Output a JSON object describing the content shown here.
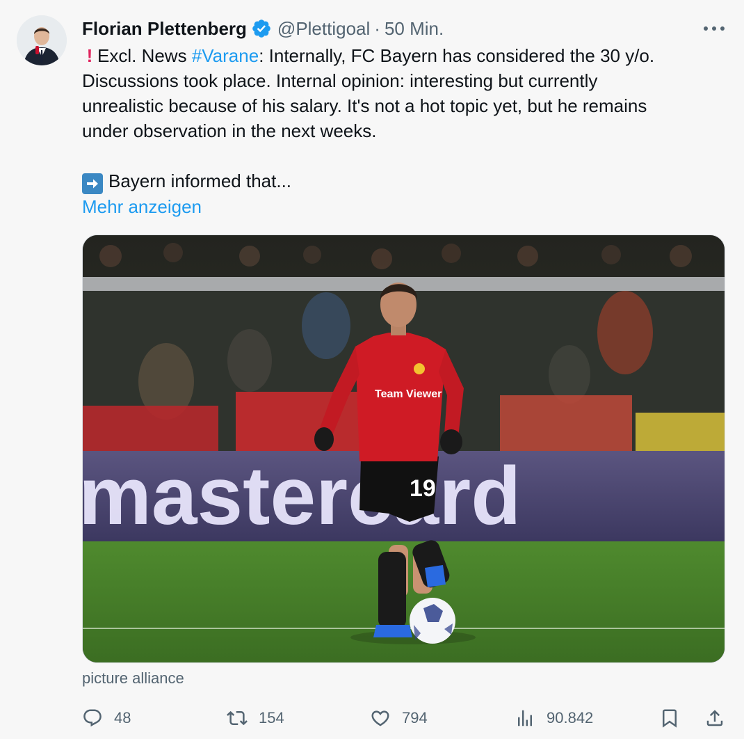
{
  "author": {
    "name": "Florian Plettenberg",
    "handle": "@Plettigoal",
    "separator": "·",
    "time": "50 Min."
  },
  "tweet": {
    "line1_prefix": "Excl. News ",
    "hashtag": "#Varane",
    "line1_suffix": ": Internally, FC Bayern has considered the 30 y/o.",
    "line2": "Discussions took place. Internal opinion: interesting but currently",
    "line3": "unrealistic because of his salary. It's not a hot topic yet, but he remains",
    "line4": "under observation in the next weeks.",
    "line5": "Bayern informed that...",
    "show_more": "Mehr anzeigen",
    "excl_icon": "red-exclamation-emoji",
    "arrow_icon": "right-arrow-emoji"
  },
  "media": {
    "board_text": "mastercard",
    "jersey_sponsor": "Team Viewer",
    "shirt_number": "19",
    "credit": "picture alliance"
  },
  "actions": {
    "replies": "48",
    "reposts": "154",
    "likes": "794",
    "views": "90.842"
  },
  "colors": {
    "accent": "#1d9bf0",
    "secondary_text": "#536471",
    "verified": "#1d9bf0"
  }
}
